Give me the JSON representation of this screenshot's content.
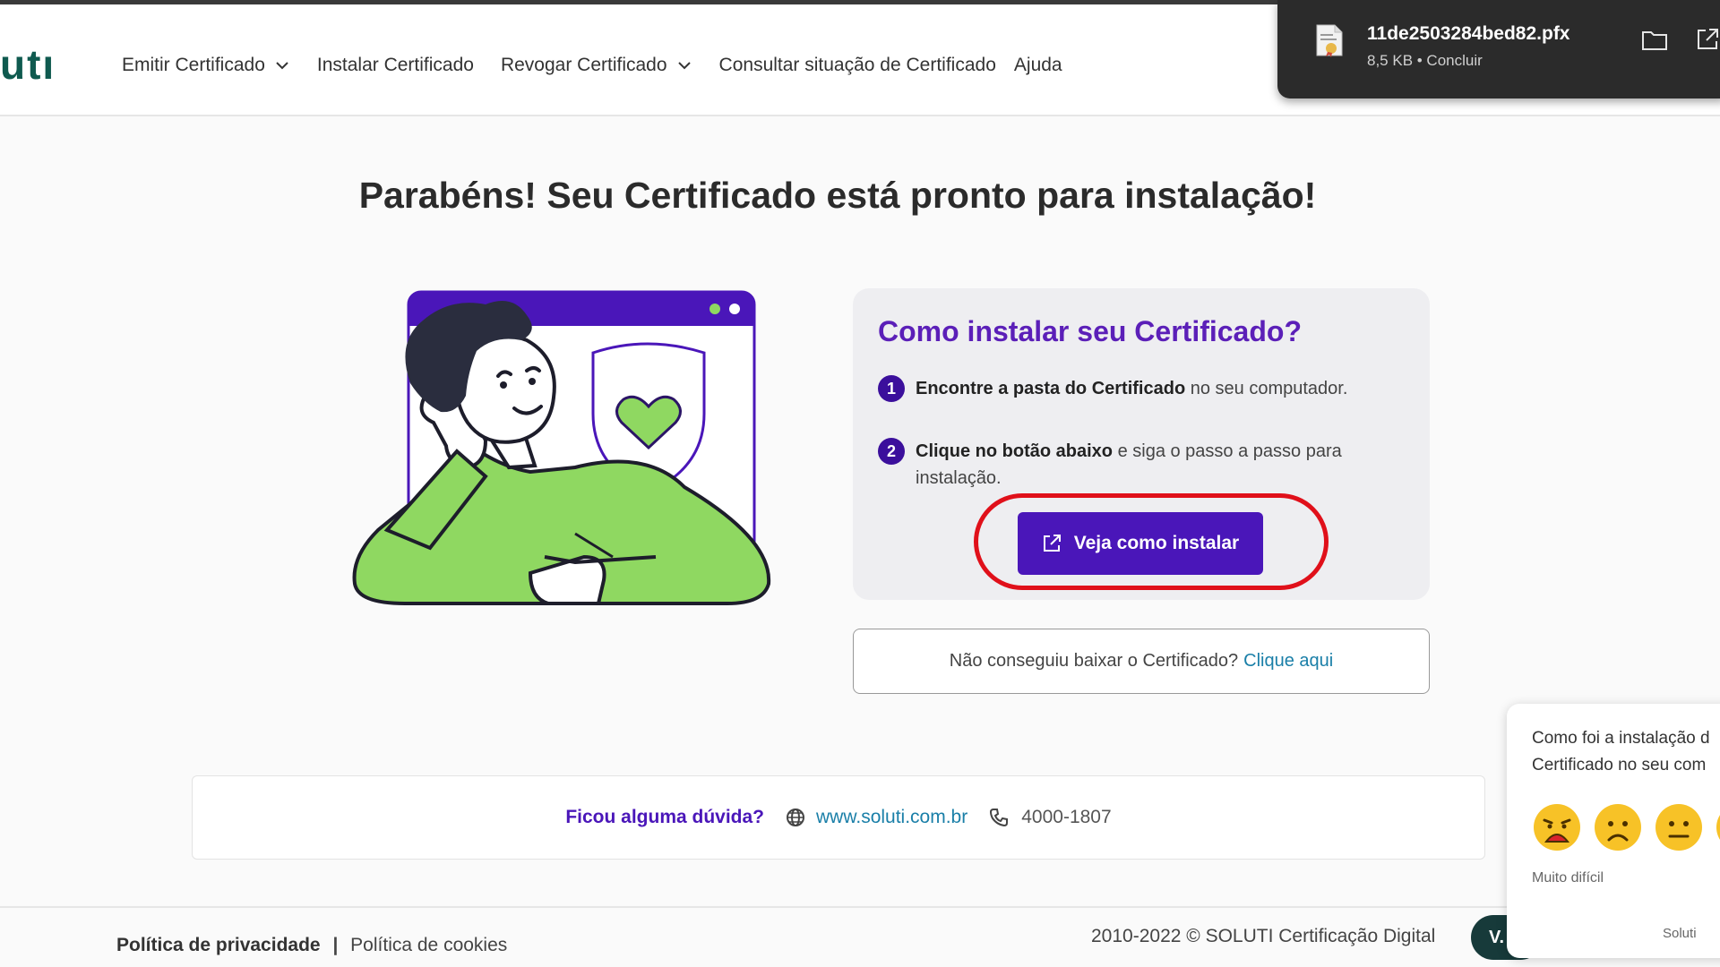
{
  "logo": {
    "text": "utı"
  },
  "nav": {
    "items": [
      {
        "label": "Emitir Certificado",
        "dropdown": true
      },
      {
        "label": "Instalar Certificado",
        "dropdown": false
      },
      {
        "label": "Revogar Certificado",
        "dropdown": true
      },
      {
        "label": "Consultar situação de Certificado",
        "dropdown": false
      },
      {
        "label": "Ajuda",
        "dropdown": false
      }
    ]
  },
  "download": {
    "filename": "11de2503284bed82.pfx",
    "status": "8,5 KB • Concluir"
  },
  "main": {
    "title": "Parabéns! Seu Certificado está pronto para instalação!"
  },
  "card": {
    "title": "Como instalar seu Certificado?",
    "steps": [
      {
        "number": "1",
        "bold": "Encontre a pasta do Certificado",
        "text": " no seu computador."
      },
      {
        "number": "2",
        "bold": "Clique no botão abaixo",
        "text": " e siga o passo a passo para instalação."
      }
    ],
    "button_label": "Veja como instalar"
  },
  "fail": {
    "text": "Não conseguiu baixar o Certificado?",
    "link": "Clique aqui"
  },
  "help": {
    "question": "Ficou alguma dúvida?",
    "website": "www.soluti.com.br",
    "phone": "4000-1807"
  },
  "footer": {
    "privacy": "Política de privacidade",
    "separator": "|",
    "cookies": "Política de cookies",
    "copyright": "2010-2022 © SOLUTI Certificação Digital",
    "version": "V."
  },
  "feedback": {
    "question_line1": "Como foi a instalação d",
    "question_line2": "Certificado no seu com",
    "label": "Muito difícil",
    "brand": "Soluti"
  },
  "colors": {
    "accent_purple": "#4a16b9",
    "title_purple": "#5b1fb8",
    "link_blue": "#1a7fa8",
    "logo_green": "#0f5a4f",
    "highlight_red": "#e0101a",
    "illustration_green": "#8fd861"
  }
}
